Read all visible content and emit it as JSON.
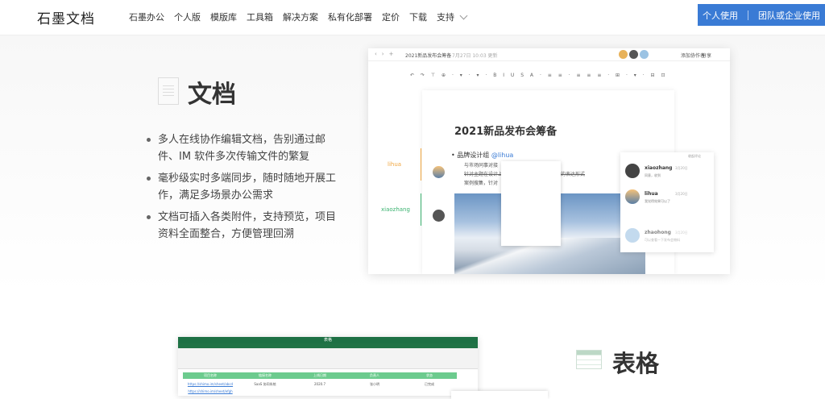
{
  "nav": {
    "logo": "石墨文档",
    "items": [
      "石墨办公",
      "个人版",
      "模版库",
      "工具箱",
      "解决方案",
      "私有化部署",
      "定价",
      "下载",
      "支持"
    ],
    "cta_personal": "个人使用",
    "cta_team": "团队或企业使用"
  },
  "doc_section": {
    "title": "文档",
    "bullets": [
      "多人在线协作编辑文档，告别通过邮件、IM 软件多次传输文件的繁复",
      "毫秒级实时多端同步，随时随地开展工作，满足多场景办公需求",
      "文档可插入各类附件，支持预览，项目资料全面整合，方便管理回溯"
    ]
  },
  "editor": {
    "doc_name": "2021新品发布会筹备",
    "saved_time": "7月27日 10:03 更新",
    "menu_share": "分享",
    "menu_collab": "添加协作者",
    "page_title": "2021新品发布会筹备",
    "heading": "品牌设计组",
    "mention": "@lihua",
    "sub1": "与市场同事对接",
    "sub2": "针对主题在设计上进行构思，确定主视觉设计的表达形式",
    "sub3": "案例搜集，针对",
    "margin_lihua": "lihua",
    "margin_xiaozhang": "xiaozhang",
    "colors": {
      "lihua": "#f0a640",
      "xiaozhang": "#3cb371"
    }
  },
  "comments": {
    "header": "收起评论",
    "items": [
      {
        "name": "xiaozhang",
        "date": "3月20日",
        "text": "同意，收到"
      },
      {
        "name": "lihua",
        "date": "3月20日",
        "text": "我觉得效果可以了"
      },
      {
        "name": "zhaohong",
        "date": "3月20日",
        "text": "可以查看一下发布会物料"
      }
    ]
  },
  "sheet_section": {
    "title": "表格",
    "window_title": "表格",
    "headers": [
      "项目名称",
      "链接名称",
      "上线日期",
      "负责人",
      "状态"
    ],
    "rows": [
      [
        "https://shimo.im/sheet/abcd",
        "SaaS 协同系统",
        "2020.7",
        "张小明",
        "已完成"
      ],
      [
        "https://shimo.im/sheet/efgh",
        "",
        "",
        "",
        ""
      ]
    ]
  }
}
